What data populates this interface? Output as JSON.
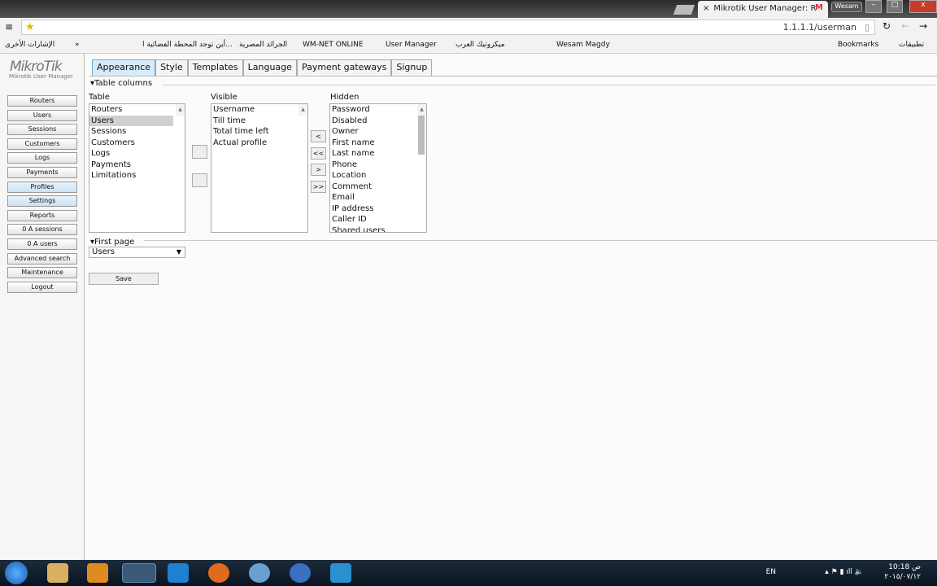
{
  "browser": {
    "tab_title": "Mikrotik User Manager: R",
    "user": "Wesam",
    "url": "1.1.1.1/userman",
    "bookmarks": [
      "الإشارات الأخرى",
      "»",
      "أين توجد المحطة الفضائية ا...",
      "الجرائد المصرية",
      "WM-NET ONLINE",
      "User Manager",
      "ميكروتيك العرب",
      "Wesam Magdy",
      "Bookmarks",
      "تطبيقات"
    ]
  },
  "logo": {
    "name": "MikroTik",
    "subtitle": "Mikrotik User Manager"
  },
  "sidebar": [
    "Routers",
    "Users",
    "Sessions",
    "Customers",
    "Logs",
    "Payments",
    "Profiles",
    "Settings",
    "Reports",
    "0 A sessions",
    "0 A users",
    "Advanced search",
    "Maintenance",
    "Logout"
  ],
  "tabs": [
    "Appearance",
    "Style",
    "Templates",
    "Language",
    "Payment gateways",
    "Signup"
  ],
  "table_columns": {
    "legend": "Table columns",
    "table_label": "Table",
    "visible_label": "Visible",
    "hidden_label": "Hidden",
    "table": [
      "Routers",
      "Users",
      "Sessions",
      "Customers",
      "Logs",
      "Payments",
      "Limitations"
    ],
    "visible": [
      "Username",
      "Till time",
      "Total time left",
      "Actual profile"
    ],
    "hidden": [
      "Password",
      "Disabled",
      "Owner",
      "First name",
      "Last name",
      "Phone",
      "Location",
      "Comment",
      "Email",
      "IP address",
      "Caller ID",
      "Shared users"
    ],
    "move_buttons": [
      "<",
      "<<",
      ">",
      ">>"
    ]
  },
  "first_page": {
    "legend": "First page",
    "value": "Users"
  },
  "save": "Save",
  "tray": {
    "lang": "EN",
    "time": "10:18 ص",
    "date": "٢٠١٥/٠٧/١٢"
  }
}
